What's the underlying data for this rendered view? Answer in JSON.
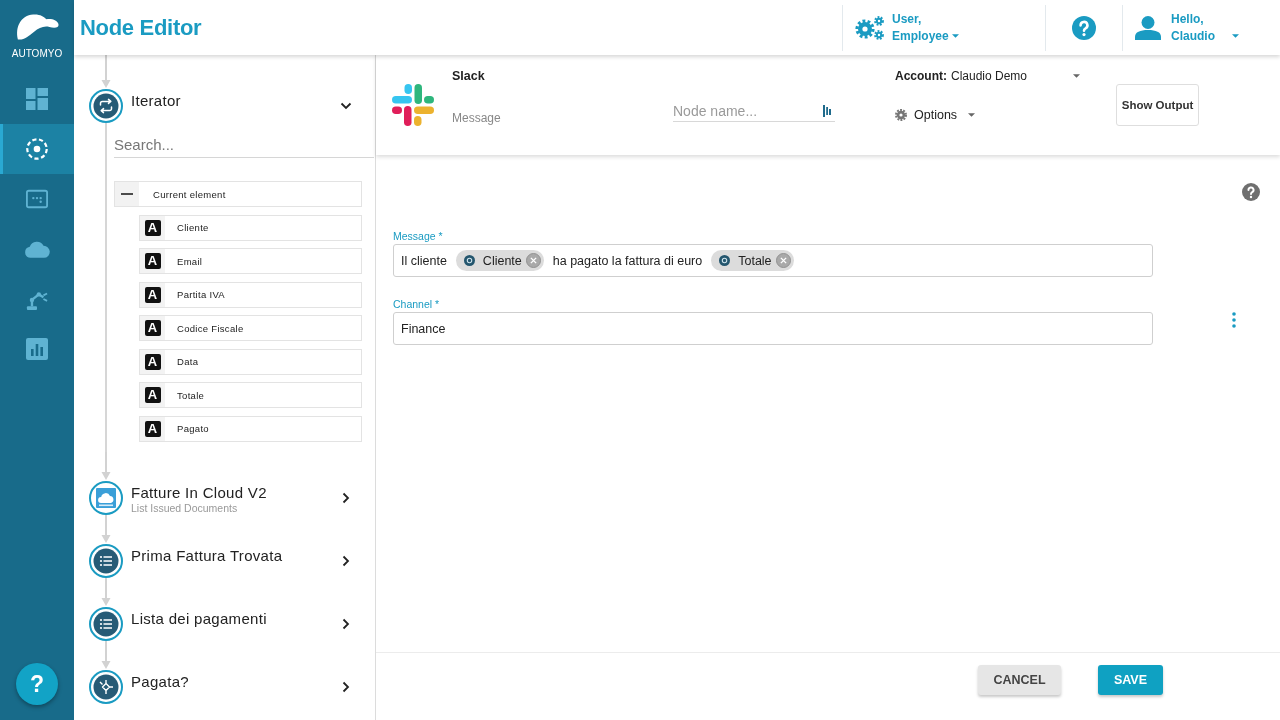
{
  "rail": {
    "logo_text": "AUTOMYO",
    "nav_items": [
      {
        "kind": "dashboard",
        "selected": false
      },
      {
        "kind": "flows",
        "selected": true
      },
      {
        "kind": "console",
        "selected": false
      },
      {
        "kind": "cloud",
        "selected": false
      },
      {
        "kind": "robot",
        "selected": false
      },
      {
        "kind": "report",
        "selected": false
      }
    ],
    "help_button": "?"
  },
  "header": {
    "title": "Node Editor",
    "role_menu": {
      "line_1": "User,",
      "line_2": "Employee"
    },
    "user_menu": {
      "line_1": "Hello,",
      "line_2": "Claudio"
    }
  },
  "flow_panel": {
    "nodes": [
      {
        "kind": "iterator",
        "title": "Iterator",
        "expanded": true,
        "search": {
          "placeholder": "Search..."
        },
        "tree": {
          "label": "Current element",
          "expanded": true,
          "children": [
            {
              "type_icon": "A",
              "label": "Cliente"
            },
            {
              "type_icon": "A",
              "label": "Email"
            },
            {
              "type_icon": "A",
              "label": "Partita IVA"
            },
            {
              "type_icon": "A",
              "label": "Codice Fiscale"
            },
            {
              "type_icon": "A",
              "label": "Data"
            },
            {
              "type_icon": "A",
              "label": "Totale"
            },
            {
              "type_icon": "A",
              "label": "Pagato"
            }
          ]
        }
      },
      {
        "kind": "app",
        "title": "Fatture In Cloud V2",
        "subtitle": "List Issued Documents",
        "expanded": false
      },
      {
        "kind": "list",
        "title": "Prima Fattura Trovata",
        "expanded": false
      },
      {
        "kind": "list",
        "title": "Lista dei pagamenti",
        "expanded": false
      },
      {
        "kind": "condition",
        "title": "Pagata?",
        "expanded": false
      }
    ]
  },
  "node_header": {
    "app_name": "Slack",
    "action": "Message",
    "node_name": {
      "placeholder": "Node name..."
    },
    "account": {
      "label": "Account:",
      "value": "Claudio Demo"
    },
    "options": "Options",
    "show_output": "Show Output"
  },
  "form": {
    "fields": [
      {
        "label": "Message *",
        "has_menu": false,
        "parts": [
          {
            "kind": "text",
            "text": "Il cliente"
          },
          {
            "kind": "chip",
            "text": "Cliente"
          },
          {
            "kind": "text",
            "text": "ha pagato la fattura di euro"
          },
          {
            "kind": "chip",
            "text": "Totale"
          }
        ]
      },
      {
        "label": "Channel *",
        "has_menu": true,
        "parts": [
          {
            "kind": "text",
            "text": "Finance"
          }
        ]
      }
    ]
  },
  "footer": {
    "buttons": [
      {
        "kind": "cancel",
        "label": "CANCEL"
      },
      {
        "kind": "save",
        "label": "SAVE"
      }
    ]
  }
}
